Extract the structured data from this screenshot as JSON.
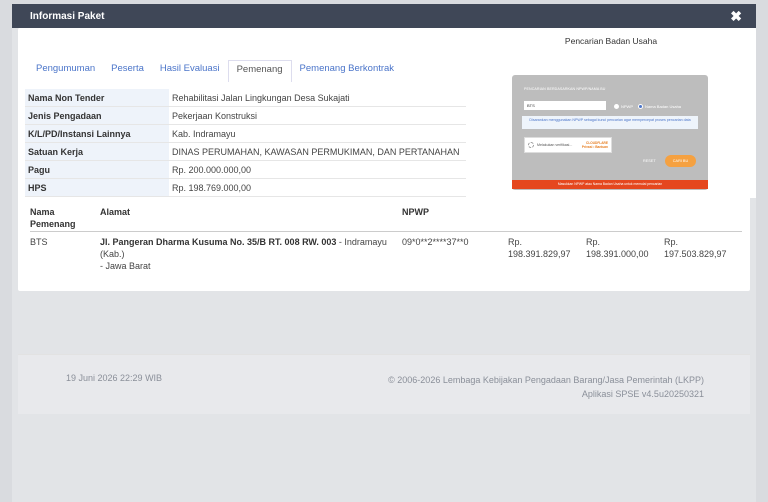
{
  "modal": {
    "title": "Informasi Paket",
    "close_symbol": "✖"
  },
  "tabs": [
    {
      "label": "Pengumuman",
      "active": false
    },
    {
      "label": "Peserta",
      "active": false
    },
    {
      "label": "Hasil Evaluasi",
      "active": false
    },
    {
      "label": "Pemenang",
      "active": true
    },
    {
      "label": "Pemenang Berkontrak",
      "active": false
    }
  ],
  "info": [
    {
      "key": "Nama Non Tender",
      "value": "Rehabilitasi Jalan Lingkungan Desa Sukajati"
    },
    {
      "key": "Jenis Pengadaan",
      "value": "Pekerjaan Konstruksi"
    },
    {
      "key": "K/L/PD/Instansi Lainnya",
      "value": "Kab. Indramayu"
    },
    {
      "key": "Satuan Kerja",
      "value": "DINAS PERUMAHAN, KAWASAN PERMUKIMAN, DAN PERTANAHAN"
    },
    {
      "key": "Pagu",
      "value": "Rp. 200.000.000,00"
    },
    {
      "key": "HPS",
      "value": "Rp. 198.769.000,00"
    }
  ],
  "winner_table": {
    "headers": {
      "name_line1": "Nama",
      "name_line2": "Pemenang",
      "address": "Alamat",
      "npwp": "NPWP"
    },
    "row": {
      "name": "BTS",
      "address_bold": "Jl. Pangeran Dharma Kusuma No. 35/B RT. 008 RW. 003",
      "address_rest": " - Indramayu (Kab.)",
      "address_line2": "- Jawa Barat",
      "npwp": "09*0**2****37**0",
      "offer": {
        "currency": "Rp.",
        "value": "198.391.829,97"
      },
      "corrected": {
        "currency": "Rp.",
        "value": "198.391.000,00"
      },
      "final": {
        "currency": "Rp.",
        "value": "197.503.829,97"
      }
    }
  },
  "search_popup": {
    "title": "Pencarian Badan Usaha",
    "label": "PENCARIAN BERDASARKAN NPWP/NAMA BU",
    "input_value": "BTS",
    "radio_npwp": "NPWP",
    "radio_name": "Nama Badan Usaha",
    "note": "Disarankan menggunakan NPWP sebagai kunci pencarian agar mempercepat proses pencarian data",
    "captcha_label": "Melakukan verifikasi...",
    "captcha_brand_line1": "CLOUDFLARE",
    "captcha_brand_line2": "Privasi • Bantuan",
    "reset_label": "RESET",
    "search_label": "CARI BU",
    "bar_text": "Masukkan NPWP atau Nama Badan Usaha untuk memulai pencarian"
  },
  "footer": {
    "date": "19 Juni 2026 22:29 WIB",
    "copyright": "© 2006-2026 Lembaga Kebijakan Pengadaan Barang/Jasa Pemerintah (LKPP)",
    "version": "Aplikasi SPSE v4.5u20250321"
  }
}
